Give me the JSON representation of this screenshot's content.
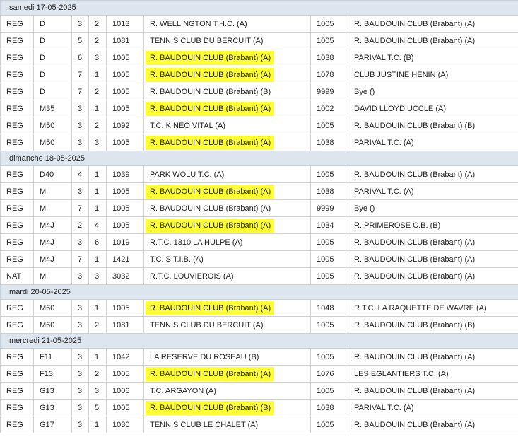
{
  "days": [
    {
      "label": "samedi 17-05-2025",
      "rows": [
        [
          "REG",
          "D",
          "3",
          "2",
          "1013",
          "R. WELLINGTON T.H.C. (A)",
          "1005",
          "R. BAUDOUIN CLUB (Brabant) (A)",
          false,
          false
        ],
        [
          "REG",
          "D",
          "5",
          "2",
          "1081",
          "TENNIS CLUB DU BERCUIT (A)",
          "1005",
          "R. BAUDOUIN CLUB (Brabant) (A)",
          false,
          false
        ],
        [
          "REG",
          "D",
          "6",
          "3",
          "1005",
          "R. BAUDOUIN CLUB (Brabant) (A)",
          "1038",
          "PARIVAL T.C. (B)",
          true,
          false
        ],
        [
          "REG",
          "D",
          "7",
          "1",
          "1005",
          "R. BAUDOUIN CLUB (Brabant) (A)",
          "1078",
          "CLUB JUSTINE HENIN (A)",
          true,
          false
        ],
        [
          "REG",
          "D",
          "7",
          "2",
          "1005",
          "R. BAUDOUIN CLUB (Brabant) (B)",
          "9999",
          "Bye ()",
          false,
          false
        ],
        [
          "REG",
          "M35",
          "3",
          "1",
          "1005",
          "R. BAUDOUIN CLUB (Brabant) (A)",
          "1002",
          "DAVID LLOYD UCCLE (A)",
          true,
          false
        ],
        [
          "REG",
          "M50",
          "3",
          "2",
          "1092",
          "T.C. KINEO VITAL (A)",
          "1005",
          "R. BAUDOUIN CLUB (Brabant) (B)",
          false,
          false
        ],
        [
          "REG",
          "M50",
          "3",
          "3",
          "1005",
          "R. BAUDOUIN CLUB (Brabant) (A)",
          "1038",
          "PARIVAL T.C. (A)",
          true,
          false
        ]
      ]
    },
    {
      "label": "dimanche 18-05-2025",
      "rows": [
        [
          "REG",
          "D40",
          "4",
          "1",
          "1039",
          "PARK WOLU T.C. (A)",
          "1005",
          "R. BAUDOUIN CLUB (Brabant) (A)",
          false,
          false
        ],
        [
          "REG",
          "M",
          "3",
          "1",
          "1005",
          "R. BAUDOUIN CLUB (Brabant) (A)",
          "1038",
          "PARIVAL T.C. (A)",
          true,
          false
        ],
        [
          "REG",
          "M",
          "7",
          "1",
          "1005",
          "R. BAUDOUIN CLUB (Brabant) (A)",
          "9999",
          "Bye ()",
          false,
          false
        ],
        [
          "REG",
          "M4J",
          "2",
          "4",
          "1005",
          "R. BAUDOUIN CLUB (Brabant) (A)",
          "1034",
          "R. PRIMEROSE C.B. (B)",
          true,
          false
        ],
        [
          "REG",
          "M4J",
          "3",
          "6",
          "1019",
          "R.T.C. 1310 LA HULPE (A)",
          "1005",
          "R. BAUDOUIN CLUB (Brabant) (A)",
          false,
          false
        ],
        [
          "REG",
          "M4J",
          "7",
          "1",
          "1421",
          "T.C. S.T.I.B. (A)",
          "1005",
          "R. BAUDOUIN CLUB (Brabant) (A)",
          false,
          false
        ],
        [
          "NAT",
          "M",
          "3",
          "3",
          "3032",
          "R.T.C. LOUVIEROIS (A)",
          "1005",
          "R. BAUDOUIN CLUB (Brabant) (A)",
          false,
          false
        ]
      ]
    },
    {
      "label": "mardi 20-05-2025",
      "rows": [
        [
          "REG",
          "M60",
          "3",
          "1",
          "1005",
          "R. BAUDOUIN CLUB (Brabant) (A)",
          "1048",
          "R.T.C. LA RAQUETTE DE WAVRE (A)",
          true,
          false
        ],
        [
          "REG",
          "M60",
          "3",
          "2",
          "1081",
          "TENNIS CLUB DU BERCUIT (A)",
          "1005",
          "R. BAUDOUIN CLUB (Brabant) (B)",
          false,
          false
        ]
      ]
    },
    {
      "label": "mercredi 21-05-2025",
      "rows": [
        [
          "REG",
          "F11",
          "3",
          "1",
          "1042",
          "LA RESERVE DU ROSEAU (B)",
          "1005",
          "R. BAUDOUIN CLUB (Brabant) (A)",
          false,
          false
        ],
        [
          "REG",
          "F13",
          "3",
          "2",
          "1005",
          "R. BAUDOUIN CLUB (Brabant) (A)",
          "1076",
          "LES EGLANTIERS T.C. (A)",
          true,
          false
        ],
        [
          "REG",
          "G13",
          "3",
          "3",
          "1006",
          "T.C. ARGAYON (A)",
          "1005",
          "R. BAUDOUIN CLUB (Brabant) (A)",
          false,
          false
        ],
        [
          "REG",
          "G13",
          "3",
          "5",
          "1005",
          "R. BAUDOUIN CLUB (Brabant) (B)",
          "1038",
          "PARIVAL T.C. (A)",
          true,
          false
        ],
        [
          "REG",
          "G17",
          "3",
          "1",
          "1030",
          "TENNIS CLUB LE CHALET (A)",
          "1005",
          "R. BAUDOUIN CLUB (Brabant) (A)",
          false,
          false
        ]
      ]
    }
  ],
  "colors": {
    "highlight": "#ffff33",
    "day_header_bg": "#dde6ef",
    "border": "#d0d0d0"
  }
}
